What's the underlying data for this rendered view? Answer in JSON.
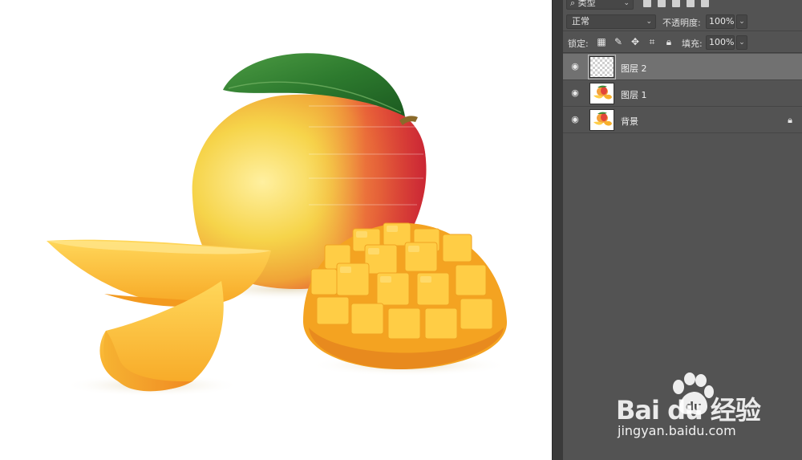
{
  "filter": {
    "kind_label": "类型"
  },
  "blend": {
    "mode": "正常",
    "opacity_label": "不透明度:",
    "opacity": "100%"
  },
  "lock": {
    "label": "锁定:",
    "fill_label": "填充:",
    "fill": "100%"
  },
  "layers": [
    {
      "name": "图层 2",
      "selected": true,
      "thumbnail": "transparent",
      "locked": false
    },
    {
      "name": "图层 1",
      "selected": false,
      "thumbnail": "mango",
      "locked": false
    },
    {
      "name": "背景",
      "selected": false,
      "thumbnail": "mango",
      "locked": true
    }
  ],
  "watermark": {
    "brand": "Bai du 经验",
    "url": "jingyan.baidu.com"
  },
  "icons": {
    "eye": "eye-icon",
    "lock": "lock-icon",
    "filter_pixel": "image-icon",
    "filter_adjust": "adjustment-icon",
    "filter_type": "type-icon",
    "filter_shape": "shape-icon",
    "filter_smart": "smart-object-icon"
  }
}
